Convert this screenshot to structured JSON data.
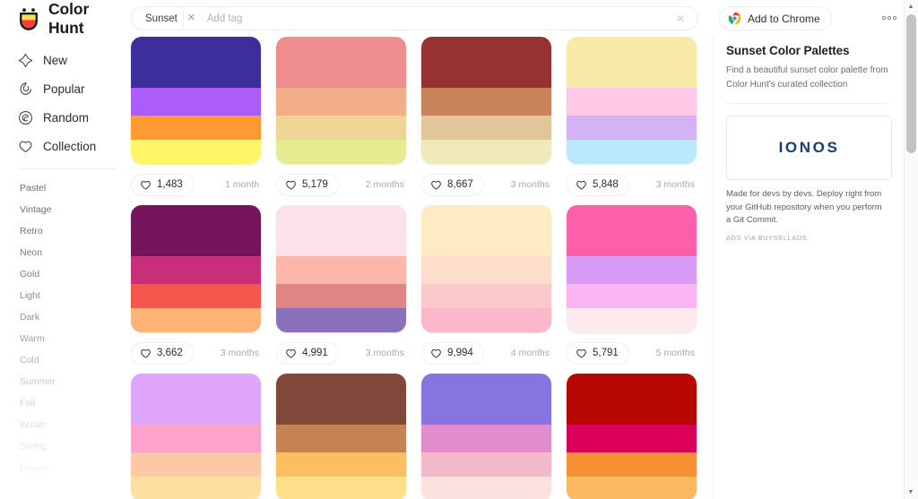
{
  "brand": {
    "name": "Color Hunt",
    "logo_icon": "colorhunt-cup-logo-icon"
  },
  "search": {
    "tag_label": "Sunset",
    "tag_remove_icon": "close-icon",
    "placeholder": "Add tag",
    "value": "",
    "clear_icon": "close-icon"
  },
  "topbar": {
    "chrome_label": "Add to Chrome",
    "chrome_icon": "chrome-icon",
    "more_icon": "more-horizontal-icon"
  },
  "sidebar": {
    "nav": [
      {
        "label": "New",
        "icon": "sparkle-icon"
      },
      {
        "label": "Popular",
        "icon": "fire-icon"
      },
      {
        "label": "Random",
        "icon": "spiral-icon"
      },
      {
        "label": "Collection",
        "icon": "heart-icon"
      }
    ],
    "tags": [
      {
        "label": "Pastel",
        "color": "#6c6c6c"
      },
      {
        "label": "Vintage",
        "color": "#707070"
      },
      {
        "label": "Retro",
        "color": "#757575"
      },
      {
        "label": "Neon",
        "color": "#7b7b7b"
      },
      {
        "label": "Gold",
        "color": "#828282"
      },
      {
        "label": "Light",
        "color": "#8a8a8a"
      },
      {
        "label": "Dark",
        "color": "#949494"
      },
      {
        "label": "Warm",
        "color": "#a0a0a0"
      },
      {
        "label": "Cold",
        "color": "#b4b4b4"
      },
      {
        "label": "Summer",
        "color": "#c6c6c6"
      },
      {
        "label": "Fall",
        "color": "#d4d4d4"
      },
      {
        "label": "Winter",
        "color": "#e0e0e0"
      },
      {
        "label": "Spring",
        "color": "#e9e9e9"
      },
      {
        "label": "Happy",
        "color": "#f1f1f1"
      }
    ]
  },
  "palettes": [
    {
      "colors": [
        "#3C2F9B",
        "#AC5CF7",
        "#FF9933",
        "#FFF566"
      ],
      "likes": "1,483",
      "age": "1 month",
      "heart_icon": "heart-icon"
    },
    {
      "colors": [
        "#EF8E8E",
        "#F2AE88",
        "#EED595",
        "#E4EB91"
      ],
      "likes": "5,179",
      "age": "2 months",
      "heart_icon": "heart-icon"
    },
    {
      "colors": [
        "#973233",
        "#C88358",
        "#E2C79A",
        "#F0E9BC"
      ],
      "likes": "8,667",
      "age": "3 months",
      "heart_icon": "heart-icon"
    },
    {
      "colors": [
        "#F8EBA8",
        "#FFC8E6",
        "#D3B3F5",
        "#BCE8FB"
      ],
      "likes": "5,848",
      "age": "3 months",
      "heart_icon": "heart-icon"
    },
    {
      "colors": [
        "#74155E",
        "#C92F78",
        "#F5574D",
        "#FFB377"
      ],
      "likes": "3,662",
      "age": "3 months",
      "heart_icon": "heart-icon"
    },
    {
      "colors": [
        "#FBE2E8",
        "#FBB7A8",
        "#E08484",
        "#8A70BA"
      ],
      "likes": "4,991",
      "age": "3 months",
      "heart_icon": "heart-icon"
    },
    {
      "colors": [
        "#FDEBC4",
        "#FDDDCB",
        "#FCC8CB",
        "#FBB8CB"
      ],
      "likes": "9,994",
      "age": "4 months",
      "heart_icon": "heart-icon"
    },
    {
      "colors": [
        "#FB60A8",
        "#D79BF5",
        "#FBB3F2",
        "#FEE9EC"
      ],
      "likes": "5,791",
      "age": "5 months",
      "heart_icon": "heart-icon"
    },
    {
      "colors": [
        "#E0A6FB",
        "#FDA2CB",
        "#FDC8A5",
        "#FFE0A0"
      ],
      "likes": "",
      "age": "",
      "heart_icon": "heart-icon"
    },
    {
      "colors": [
        "#80483A",
        "#C58352",
        "#FDBE62",
        "#FFE08A"
      ],
      "likes": "",
      "age": "",
      "heart_icon": "heart-icon"
    },
    {
      "colors": [
        "#8874E0",
        "#E08CCD",
        "#F3BACB",
        "#FBE2DF"
      ],
      "likes": "",
      "age": "",
      "heart_icon": "heart-icon"
    },
    {
      "colors": [
        "#B70800",
        "#DB0058",
        "#F69034",
        "#FBB862"
      ],
      "likes": "",
      "age": "",
      "heart_icon": "heart-icon"
    }
  ],
  "right_panel": {
    "title": "Sunset Color Palettes",
    "description": "Find a beautiful sunset color palette from Color Hunt's curated collection",
    "ad": {
      "logo_text": "IONOS",
      "copy": "Made for devs by devs. Deploy right from your GitHub repository when you perform a Git Commit.",
      "attribution": "ADS VIA BUYSELLADS"
    }
  },
  "scrollbar": {
    "up_icon": "caret-up-icon",
    "down_icon": "caret-down-icon"
  }
}
